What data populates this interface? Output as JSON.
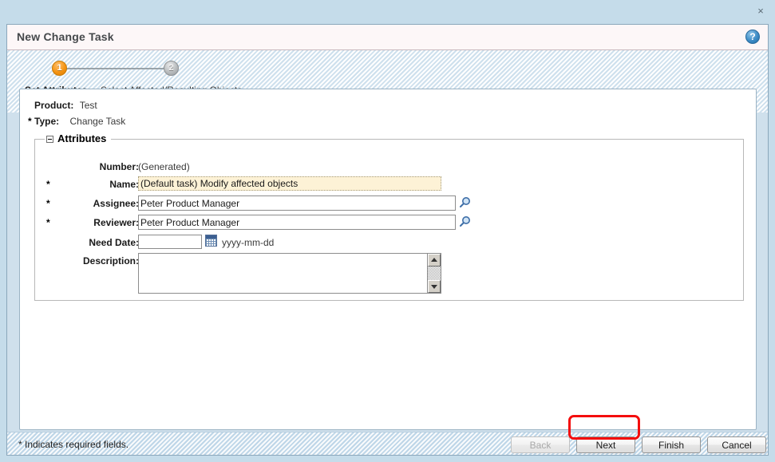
{
  "window": {
    "close_label": "×"
  },
  "dialog": {
    "title": "New Change Task",
    "help_icon_label": "?"
  },
  "wizard": {
    "steps": [
      {
        "number": "1",
        "label": "Set Attributes",
        "state": "active"
      },
      {
        "number": "2",
        "label": "Select Affected/Resulting Objects",
        "state": "inactive"
      }
    ]
  },
  "header_fields": [
    {
      "label": "Product:",
      "value": "Test",
      "required": false
    },
    {
      "label": "Type:",
      "value": "Change Task",
      "required": true
    }
  ],
  "group": {
    "title": "Attributes",
    "collapsed": false
  },
  "fields": {
    "number": {
      "label": "Number:",
      "value": "(Generated)",
      "required": false
    },
    "name": {
      "label": "Name:",
      "value": "(Default task) Modify affected objects",
      "required": true,
      "highlighted": true
    },
    "assignee": {
      "label": "Assignee:",
      "value": "Peter Product Manager",
      "required": true
    },
    "reviewer": {
      "label": "Reviewer:",
      "value": "Peter Product Manager",
      "required": true
    },
    "need_date": {
      "label": "Need Date:",
      "value": "",
      "required": false,
      "format_hint": "yyyy-mm-dd"
    },
    "description": {
      "label": "Description:",
      "value": "",
      "required": false
    }
  },
  "footer": {
    "note": "* Indicates required fields.",
    "buttons": [
      {
        "label": "Back",
        "enabled": false
      },
      {
        "label": "Next",
        "enabled": true,
        "highlighted": true
      },
      {
        "label": "Finish",
        "enabled": true
      },
      {
        "label": "Cancel",
        "enabled": true
      }
    ]
  },
  "required_marker": "*",
  "colors": {
    "window_background": "#c5dcea",
    "panel_background": "#ffffff",
    "title_background": "#fdf7f8",
    "active_step": "#f59412",
    "inactive_step": "#b9bcbe",
    "highlight_field": "#fdf2d6",
    "annotation_red": "#f40d0d"
  }
}
